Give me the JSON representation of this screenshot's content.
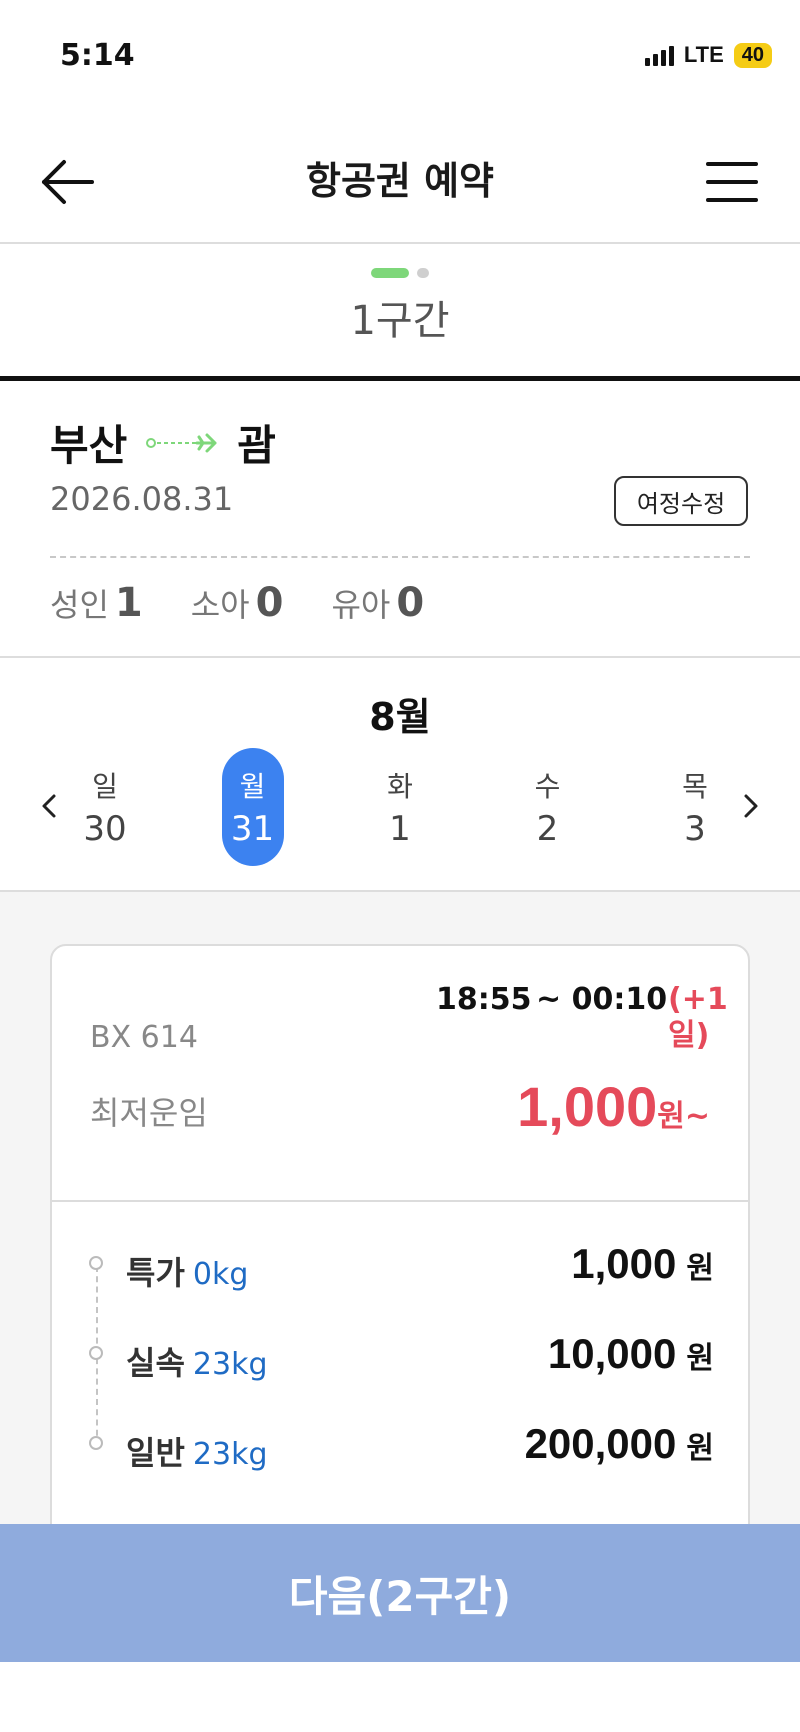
{
  "status_bar": {
    "time": "5:14",
    "network": "LTE",
    "battery": "40"
  },
  "header": {
    "title": "항공권 예약"
  },
  "segment": {
    "label": "1구간"
  },
  "route": {
    "origin": "부산",
    "destination": "괌",
    "date": "2026.08.31",
    "edit_label": "여정수정"
  },
  "passengers": [
    {
      "label": "성인",
      "count": "1"
    },
    {
      "label": "소아",
      "count": "0"
    },
    {
      "label": "유아",
      "count": "0"
    }
  ],
  "calendar": {
    "month": "8월",
    "days": [
      {
        "dow": "일",
        "num": "30",
        "selected": false
      },
      {
        "dow": "월",
        "num": "31",
        "selected": true
      },
      {
        "dow": "화",
        "num": "1",
        "selected": false
      },
      {
        "dow": "수",
        "num": "2",
        "selected": false
      },
      {
        "dow": "목",
        "num": "3",
        "selected": false
      }
    ]
  },
  "flight": {
    "number": "BX 614",
    "departure": "18:55",
    "arrival": "~ 00:10",
    "day_offset": "(+1일)",
    "lowest_label": "최저운임",
    "lowest_price": "1,000",
    "lowest_unit": "원~",
    "fares": [
      {
        "name": "특가",
        "baggage": "0kg",
        "price": "1,000",
        "unit": "원"
      },
      {
        "name": "실속",
        "baggage": "23kg",
        "price": "10,000",
        "unit": "원"
      },
      {
        "name": "일반",
        "baggage": "23kg",
        "price": "200,000",
        "unit": "원"
      }
    ]
  },
  "next_button": {
    "label": "다음(2구간)"
  },
  "colors": {
    "accent_blue": "#3c82f0",
    "price_red": "#e54a5a",
    "baggage_blue": "#1f6bc4",
    "next_button": "#8fabdd",
    "segment_green": "#7ed77a"
  }
}
